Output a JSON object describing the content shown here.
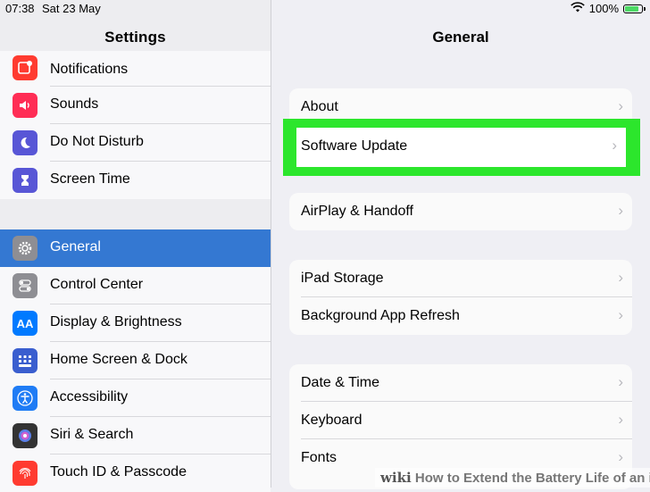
{
  "status_bar": {
    "time": "07:38",
    "date": "Sat 23 May",
    "battery": "100%"
  },
  "sidebar": {
    "title": "Settings",
    "group1": [
      {
        "label": "Notifications",
        "icon": "notifications-icon",
        "color": "#ff3b30"
      },
      {
        "label": "Sounds",
        "icon": "speaker-icon",
        "color": "#ff2d55"
      },
      {
        "label": "Do Not Disturb",
        "icon": "moon-icon",
        "color": "#5856d6"
      },
      {
        "label": "Screen Time",
        "icon": "hourglass-icon",
        "color": "#5856d6"
      }
    ],
    "group2": [
      {
        "label": "General",
        "icon": "gear-icon",
        "color": "#8e8e93",
        "selected": true
      },
      {
        "label": "Control Center",
        "icon": "toggles-icon",
        "color": "#8e8e93"
      },
      {
        "label": "Display & Brightness",
        "icon": "aa-icon",
        "color": "#007aff"
      },
      {
        "label": "Home Screen & Dock",
        "icon": "grid-icon",
        "color": "#3a5ecf"
      },
      {
        "label": "Accessibility",
        "icon": "accessibility-icon",
        "color": "#1f7cf5"
      },
      {
        "label": "Siri & Search",
        "icon": "siri-icon",
        "color": "#333333"
      },
      {
        "label": "Touch ID & Passcode",
        "icon": "fingerprint-icon",
        "color": "#ff3b30"
      }
    ]
  },
  "main": {
    "title": "General",
    "about": "About",
    "software_update": "Software Update",
    "airplay": "AirPlay & Handoff",
    "ipad_storage": "iPad Storage",
    "background_refresh": "Background App Refresh",
    "date_time": "Date & Time",
    "keyboard": "Keyboard",
    "fonts": "Fonts",
    "chevron": "›"
  },
  "watermark": {
    "wiki": "wiki",
    "text": "How to Extend the Battery Life of an iPad"
  },
  "colors": {
    "highlight": "#2ce62c",
    "selected_row": "#3478d2"
  }
}
